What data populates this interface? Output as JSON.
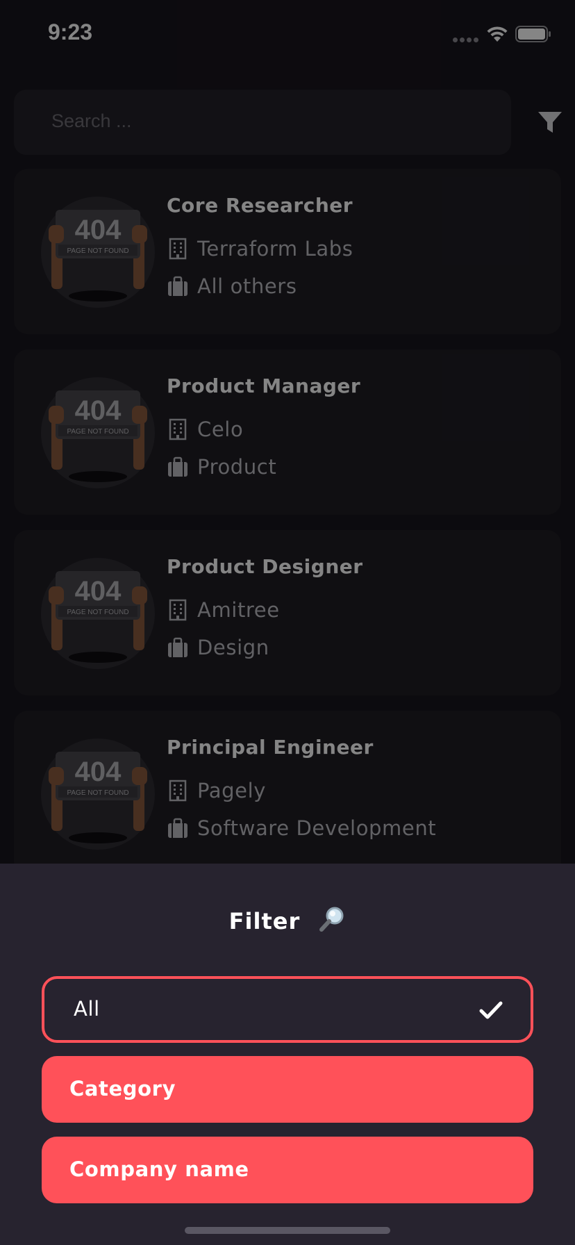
{
  "status_bar": {
    "time": "9:23"
  },
  "search": {
    "placeholder": "Search ..."
  },
  "jobs": [
    {
      "title": "Core Researcher",
      "company": "Terraform Labs",
      "category": "All others",
      "image_text": "404",
      "image_subtext": "PAGE NOT FOUND"
    },
    {
      "title": "Product Manager",
      "company": "Celo",
      "category": "Product",
      "image_text": "404",
      "image_subtext": "PAGE NOT FOUND"
    },
    {
      "title": "Product Designer",
      "company": "Amitree",
      "category": "Design",
      "image_text": "404",
      "image_subtext": "PAGE NOT FOUND"
    },
    {
      "title": "Principal Engineer",
      "company": "Pagely",
      "category": "Software Development",
      "image_text": "404",
      "image_subtext": "PAGE NOT FOUND"
    }
  ],
  "filter_sheet": {
    "title": "Filter",
    "title_icon": "magnifying-glass-emoji",
    "options": [
      {
        "label": "All",
        "selected": true
      },
      {
        "label": "Category",
        "selected": false
      },
      {
        "label": "Company name",
        "selected": false
      }
    ]
  },
  "colors": {
    "background": "#18161d",
    "card": "#1f1d24",
    "sheet": "#27232f",
    "accent": "#ff5159"
  }
}
